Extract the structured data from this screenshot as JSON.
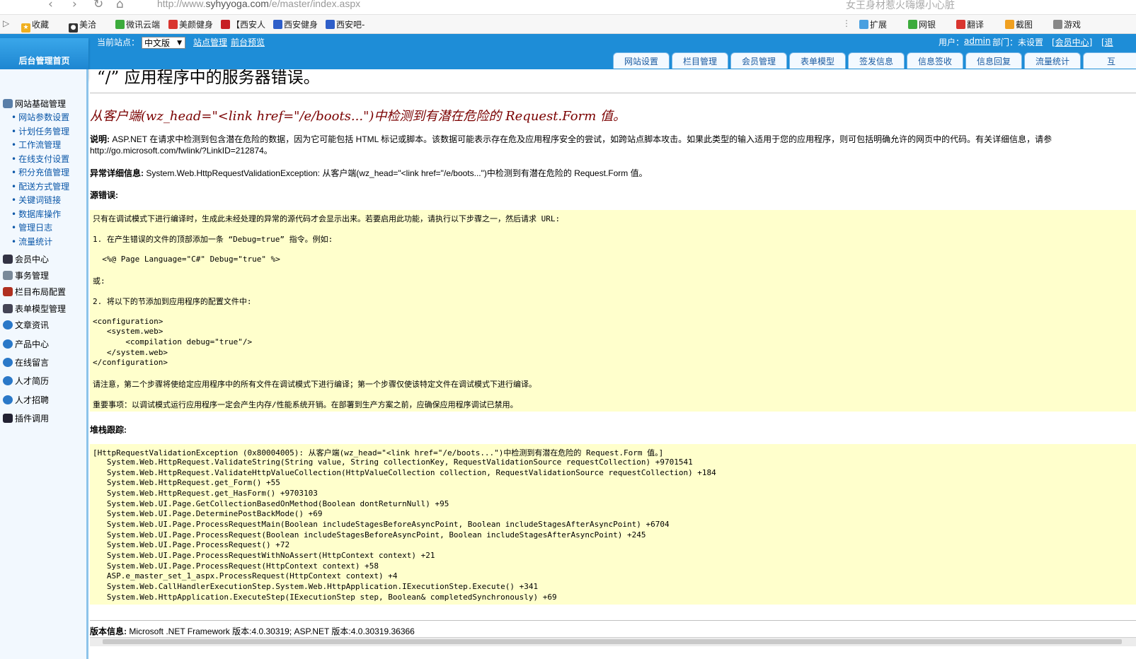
{
  "browser": {
    "url_prefix": "http://www.",
    "url_domain": "syhyyoga.com",
    "url_path": "/e/master/index.aspx",
    "search_text": "女王身材惹火嗨爆小心脏",
    "bookmarks": [
      "收藏",
      "美洽",
      "微讯云端",
      "美颜健身",
      "【西安人",
      "西安健身",
      "西安吧-"
    ],
    "tools": [
      "扩展",
      "网银",
      "翻译",
      "截图",
      "游戏"
    ]
  },
  "header": {
    "home_button": "后台管理首页",
    "current_site_label": "当前站点：",
    "site_select_value": "中文版",
    "site_manage_link": "站点管理",
    "preview_link": "前台预览",
    "user_label": "用户：",
    "user_name": "admin",
    "dept_label": "部门：未设置",
    "member_center_link": "[会员中心]",
    "extra_link": "[退",
    "tabs": [
      "网站设置",
      "栏目管理",
      "会员管理",
      "表单模型",
      "签发信息",
      "信息签收",
      "信息回复",
      "流量统计",
      "互"
    ]
  },
  "sidebar": {
    "groups": [
      {
        "label": "网站基础管理",
        "items": [
          "网站参数设置",
          "计划任务管理",
          "工作流管理",
          "在线支付设置",
          "积分充值管理",
          "配送方式管理",
          "关键词链接",
          "数据库操作",
          "管理日志",
          "流量统计"
        ]
      },
      {
        "label": "会员中心"
      },
      {
        "label": "事务管理"
      },
      {
        "label": "栏目布局配置"
      },
      {
        "label": "表单模型管理"
      },
      {
        "label": "文章资讯"
      },
      {
        "label": "产品中心"
      },
      {
        "label": "在线留言"
      },
      {
        "label": "人才简历"
      },
      {
        "label": "人才招聘"
      },
      {
        "label": "插件调用"
      }
    ]
  },
  "error": {
    "title": "“/” 应用程序中的服务器错误。",
    "heading": "从客户端(wz_head=\"<link href=\"/e/boots...\")中检测到有潜在危险的 Request.Form 值。",
    "desc_label": "说明:",
    "desc_text": " ASP.NET 在请求中检测到包含潜在危险的数据，因为它可能包括 HTML 标记或脚本。该数据可能表示存在危及应用程序安全的尝试，如跨站点脚本攻击。如果此类型的输入适用于您的应用程序，则可包括明确允许的网页中的代码。有关详细信息，请参",
    "desc_link": "http://go.microsoft.com/fwlink/?LinkID=212874。",
    "exception_label": "异常详细信息:",
    "exception_text": " System.Web.HttpRequestValidationException: 从客户端(wz_head=\"<link href=\"/e/boots...\")中检测到有潜在危险的 Request.Form 值。",
    "source_label": "源错误:",
    "source_lines": [
      "只有在调试模式下进行编译时，生成此未经处理的异常的源代码才会显示出来。若要启用此功能，请执行以下步骤之一，然后请求 URL:",
      "1. 在产生错误的文件的顶部添加一条 “Debug=true” 指令。例如:",
      "  <%@ Page Language=\"C#\" Debug=\"true\" %>",
      "或:",
      "2. 将以下的节添加到应用程序的配置文件中:",
      "<configuration>",
      "   <system.web>",
      "       <compilation debug=\"true\"/>",
      "   </system.web>",
      "</configuration>",
      "请注意，第二个步骤将使给定应用程序中的所有文件在调试模式下进行编译；第一个步骤仅使该特定文件在调试模式下进行编译。",
      "重要事项：以调试模式运行应用程序一定会产生内存/性能系统开销。在部署到生产方案之前，应确保应用程序调试已禁用。"
    ],
    "stack_label": "堆栈跟踪:",
    "stack_lines": [
      "[HttpRequestValidationException (0x80004005): 从客户端(wz_head=\"<link href=\"/e/boots...\")中检测到有潜在危险的 Request.Form 值。]",
      "   System.Web.HttpRequest.ValidateString(String value, String collectionKey, RequestValidationSource requestCollection) +9701541",
      "   System.Web.HttpRequest.ValidateHttpValueCollection(HttpValueCollection collection, RequestValidationSource requestCollection) +184",
      "   System.Web.HttpRequest.get_Form() +55",
      "   System.Web.HttpRequest.get_HasForm() +9703103",
      "   System.Web.UI.Page.GetCollectionBasedOnMethod(Boolean dontReturnNull) +95",
      "   System.Web.UI.Page.DeterminePostBackMode() +69",
      "   System.Web.UI.Page.ProcessRequestMain(Boolean includeStagesBeforeAsyncPoint, Boolean includeStagesAfterAsyncPoint) +6704",
      "   System.Web.UI.Page.ProcessRequest(Boolean includeStagesBeforeAsyncPoint, Boolean includeStagesAfterAsyncPoint) +245",
      "   System.Web.UI.Page.ProcessRequest() +72",
      "   System.Web.UI.Page.ProcessRequestWithNoAssert(HttpContext context) +21",
      "   System.Web.UI.Page.ProcessRequest(HttpContext context) +58",
      "   ASP.e_master_set_1_aspx.ProcessRequest(HttpContext context) +4",
      "   System.Web.CallHandlerExecutionStep.System.Web.HttpApplication.IExecutionStep.Execute() +341",
      "   System.Web.HttpApplication.ExecuteStep(IExecutionStep step, Boolean& completedSynchronously) +69"
    ],
    "version_label": "版本信息:",
    "version_text": " Microsoft .NET Framework 版本:4.0.30319; ASP.NET 版本:4.0.30319.36366"
  },
  "colors": {
    "header_blue": "#1e8dd7",
    "code_background": "#ffffcc",
    "sidebar_link": "#0b57a8"
  }
}
